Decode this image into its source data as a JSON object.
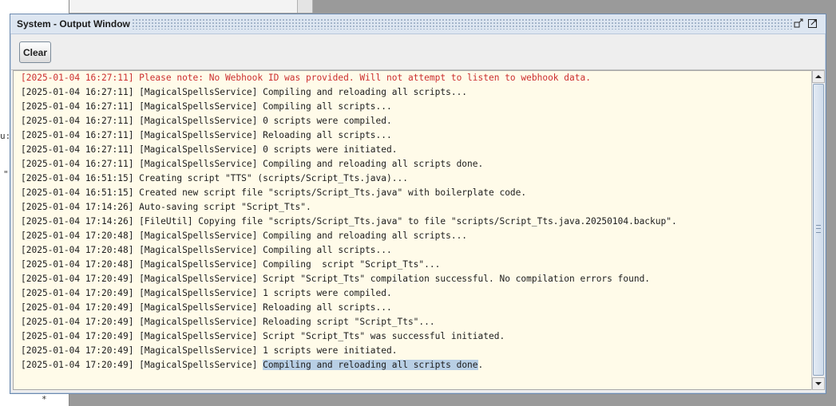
{
  "window": {
    "title": "System - Output Window",
    "buttons": [
      {
        "icon": "minimize-icon"
      },
      {
        "icon": "maximize-icon"
      }
    ]
  },
  "background": {
    "marks": [
      "u:",
      "\"",
      "*"
    ]
  },
  "toolbar": {
    "clear_label": "Clear"
  },
  "log": {
    "lines": [
      {
        "text": "[2025-01-04 16:27:11] Please note: No Webhook ID was provided. Will not attempt to listen to webhook data.",
        "level": "warn"
      },
      {
        "text": "[2025-01-04 16:27:11] [MagicalSpellsService] Compiling and reloading all scripts..."
      },
      {
        "text": "[2025-01-04 16:27:11] [MagicalSpellsService] Compiling all scripts..."
      },
      {
        "text": "[2025-01-04 16:27:11] [MagicalSpellsService] 0 scripts were compiled."
      },
      {
        "text": "[2025-01-04 16:27:11] [MagicalSpellsService] Reloading all scripts..."
      },
      {
        "text": "[2025-01-04 16:27:11] [MagicalSpellsService] 0 scripts were initiated."
      },
      {
        "text": "[2025-01-04 16:27:11] [MagicalSpellsService] Compiling and reloading all scripts done."
      },
      {
        "text": "[2025-01-04 16:51:15] Creating script \"TTS\" (scripts/Script_Tts.java)..."
      },
      {
        "text": "[2025-01-04 16:51:15] Created new script file \"scripts/Script_Tts.java\" with boilerplate code."
      },
      {
        "text": "[2025-01-04 17:14:26] Auto-saving script \"Script_Tts\"."
      },
      {
        "text": "[2025-01-04 17:14:26] [FileUtil] Copying file \"scripts/Script_Tts.java\" to file \"scripts/Script_Tts.java.20250104.backup\"."
      },
      {
        "text": "[2025-01-04 17:20:48] [MagicalSpellsService] Compiling and reloading all scripts..."
      },
      {
        "text": "[2025-01-04 17:20:48] [MagicalSpellsService] Compiling all scripts..."
      },
      {
        "text": "[2025-01-04 17:20:48] [MagicalSpellsService] Compiling  script \"Script_Tts\"..."
      },
      {
        "text": "[2025-01-04 17:20:49] [MagicalSpellsService] Script \"Script_Tts\" compilation successful. No compilation errors found."
      },
      {
        "text": "[2025-01-04 17:20:49] [MagicalSpellsService] 1 scripts were compiled."
      },
      {
        "text": "[2025-01-04 17:20:49] [MagicalSpellsService] Reloading all scripts..."
      },
      {
        "text": "[2025-01-04 17:20:49] [MagicalSpellsService] Reloading script \"Script_Tts\"..."
      },
      {
        "text": "[2025-01-04 17:20:49] [MagicalSpellsService] Script \"Script_Tts\" was successful initiated."
      },
      {
        "text": "[2025-01-04 17:20:49] [MagicalSpellsService] 1 scripts were initiated."
      },
      {
        "text": "[2025-01-04 17:20:49] [MagicalSpellsService] ",
        "selected": "Compiling and reloading all scripts done",
        "after": "."
      }
    ]
  },
  "colors": {
    "warning_text": "#cc2f2f",
    "log_background": "#fffbe9",
    "selection": "#b8cfe5",
    "title_bar": "#dde6f1"
  }
}
